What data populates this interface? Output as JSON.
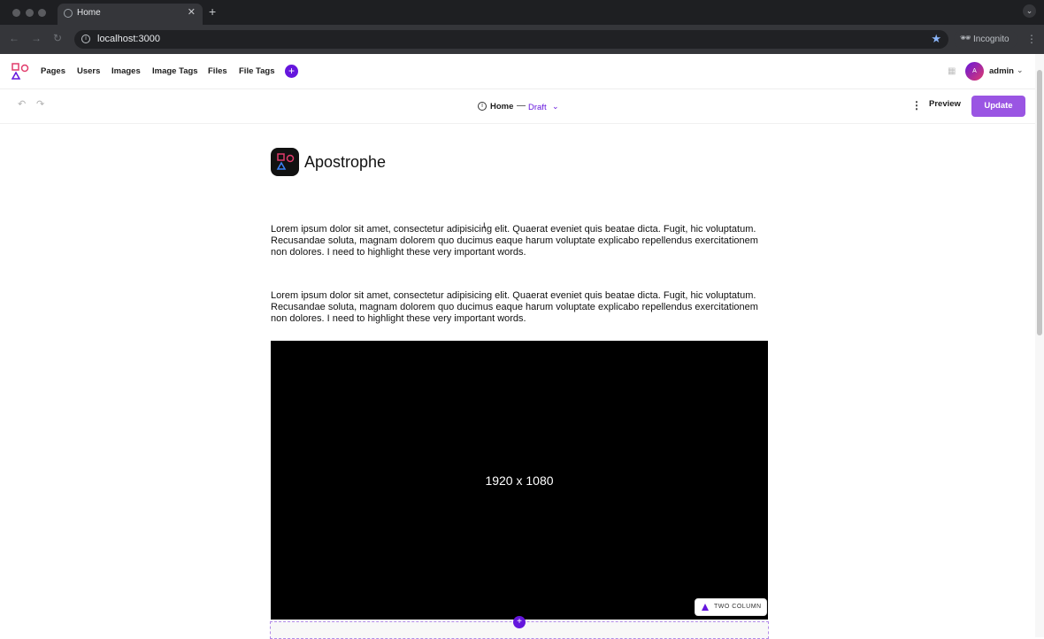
{
  "browser": {
    "tab_title": "Home",
    "url": "localhost:3000",
    "incognito_label": "Incognito"
  },
  "admin_bar": {
    "nav": [
      "Pages",
      "Users",
      "Images",
      "Image Tags",
      "Files",
      "File Tags"
    ],
    "add_label": "+",
    "user_initial": "A",
    "user_name": "admin"
  },
  "context_bar": {
    "page_title": "Home",
    "separator": "—",
    "status": "Draft",
    "preview_label": "Preview",
    "update_label": "Update"
  },
  "page": {
    "brand_name": "Apostrophe",
    "paragraphs": [
      "Lorem ipsum dolor sit amet, consectetur adipisicing elit. Quaerat eveniet quis beatae dicta. Fugit, hic voluptatum. Recusandae soluta, magnam dolorem quo ducimus eaque harum voluptate explicabo repellendus exercitationem non dolores. I need to highlight these very important words.",
      "Lorem ipsum dolor sit amet, consectetur adipisicing elit. Quaerat eveniet quis beatae dicta. Fugit, hic voluptatum. Recusandae soluta, magnam dolorem quo ducimus eaque harum voluptate explicabo repellendus exercitationem non dolores. I need to highlight these very important words."
    ],
    "image_dims": "1920 x 1080",
    "widget_badge": "TWO COLUMN",
    "add_widget_label": "+"
  },
  "colors": {
    "accent": "#6516dd",
    "update_button": "#9a55e3"
  }
}
